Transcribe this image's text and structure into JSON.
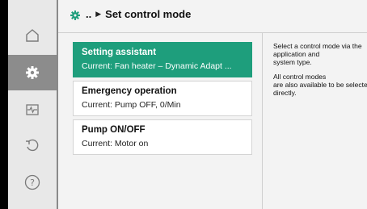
{
  "header": {
    "dots": "..",
    "arrow": "▶",
    "title": "Set control mode"
  },
  "sidebar": {
    "items": [
      {
        "icon": "home-icon"
      },
      {
        "icon": "settings-icon",
        "active": true
      },
      {
        "icon": "diagnostics-icon"
      },
      {
        "icon": "restore-icon"
      },
      {
        "icon": "help-icon"
      }
    ]
  },
  "menu": {
    "items": [
      {
        "title": "Setting assistant",
        "sub": "Current: Fan heater – Dynamic Adapt ...",
        "selected": true
      },
      {
        "title": "Emergency operation",
        "sub": "Current: Pump OFF, 0/Min",
        "selected": false
      },
      {
        "title": "Pump ON/OFF",
        "sub": "Current: Motor on",
        "selected": false
      }
    ]
  },
  "help": {
    "line1": "Select a control mode via the",
    "line2": "application and",
    "line3": "system type.",
    "line4": "All control modes",
    "line5": "are also available to be selected",
    "line6": "directly."
  },
  "colors": {
    "accent": "#1e9e7c",
    "sidebar_active": "#8c8c8c"
  }
}
